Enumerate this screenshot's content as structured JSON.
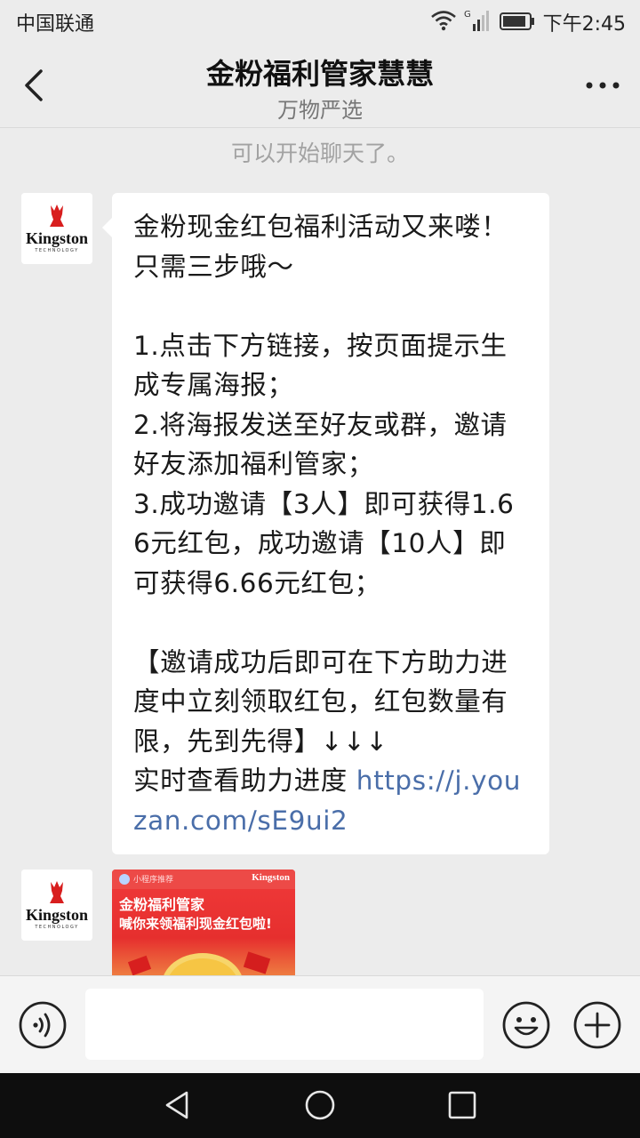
{
  "status_bar": {
    "carrier": "中国联通",
    "time": "下午2:45",
    "icons": [
      "wifi-icon",
      "signal-icon",
      "battery-icon"
    ]
  },
  "header": {
    "title": "金粉福利管家慧慧",
    "subtitle": "万物严选",
    "back_icon": "chevron-left-icon",
    "more_icon": "more-dots-icon"
  },
  "chat": {
    "system_message": "可以开始聊天了。",
    "messages": [
      {
        "sender": "Kingston",
        "text": "金粉现金红包福利活动又来喽！只需三步哦～\n\n1.点击下方链接，按页面提示生成专属海报；\n2.将海报发送至好友或群，邀请好友添加福利管家；\n3.成功邀请【3人】即可获得1.66元红包，成功邀请【10人】即可获得6.66元红包；\n\n【邀请成功后即可在下方助力进度中立刻领取红包，红包数量有限，先到先得】↓↓↓\n实时查看助力进度 ",
        "link": "https://j.youzan.com/sE9ui2"
      },
      {
        "sender": "Kingston",
        "poster": {
          "brand": "Kingston",
          "small_label": "小程序推荐",
          "line1": "金粉福利管家",
          "line2": "喊你来领福利现金红包啦!"
        }
      }
    ]
  },
  "input_bar": {
    "voice_icon": "voice-icon",
    "emoji_icon": "emoji-icon",
    "plus_icon": "plus-icon"
  },
  "nav_bar": {
    "icons": [
      "nav-back-icon",
      "nav-home-icon",
      "nav-recent-icon"
    ]
  },
  "colors": {
    "background": "#ececec",
    "link": "#4a6ea9",
    "bubble": "#ffffff",
    "poster_red": "#e62f2e"
  }
}
